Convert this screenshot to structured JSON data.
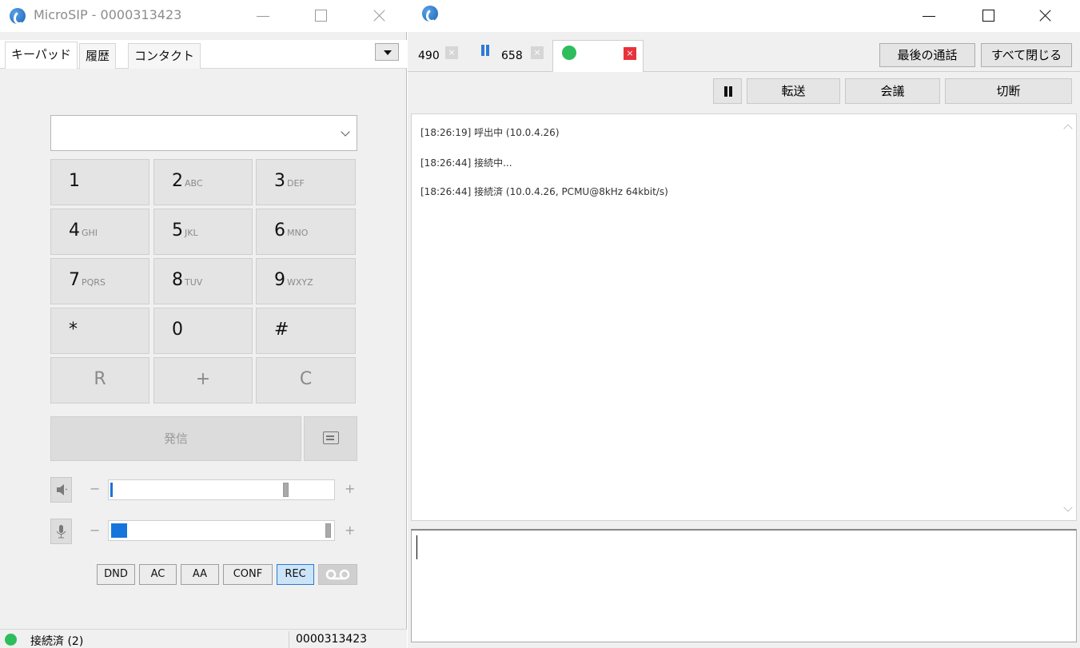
{
  "left_window": {
    "title": "MicroSIP - 0000313423",
    "tabs": [
      {
        "label": "キーパッド",
        "active": true
      },
      {
        "label": "履歴",
        "active": false
      },
      {
        "label": "コンタクト",
        "active": false
      }
    ],
    "dial_input": {
      "value": ""
    },
    "keypad": [
      {
        "digit": "1",
        "letters": ""
      },
      {
        "digit": "2",
        "letters": "ABC"
      },
      {
        "digit": "3",
        "letters": "DEF"
      },
      {
        "digit": "4",
        "letters": "GHI"
      },
      {
        "digit": "5",
        "letters": "JKL"
      },
      {
        "digit": "6",
        "letters": "MNO"
      },
      {
        "digit": "7",
        "letters": "PQRS"
      },
      {
        "digit": "8",
        "letters": "TUV"
      },
      {
        "digit": "9",
        "letters": "WXYZ"
      },
      {
        "digit": "*",
        "letters": ""
      },
      {
        "digit": "0",
        "letters": ""
      },
      {
        "digit": "#",
        "letters": ""
      }
    ],
    "keypad_extra": [
      "R",
      "+",
      "C"
    ],
    "call_label": "発信",
    "speaker": {
      "minus": "−",
      "plus": "+",
      "level": 0.01
    },
    "microphone": {
      "minus": "−",
      "plus": "+",
      "level": 0.07
    },
    "flags": [
      {
        "label": "DND",
        "active": false
      },
      {
        "label": "AC",
        "active": false
      },
      {
        "label": "AA",
        "active": false
      },
      {
        "label": "CONF",
        "active": false
      },
      {
        "label": "REC",
        "active": true
      }
    ],
    "status": {
      "text": "接続済 (2)",
      "account": "0000313423",
      "color": "#2ebd5c"
    }
  },
  "right_window": {
    "call_tabs": [
      {
        "label": "490",
        "state": "idle"
      },
      {
        "label": "658",
        "state": "hold"
      },
      {
        "label": "",
        "state": "active"
      }
    ],
    "top_buttons": [
      "最後の通話",
      "すべて閉じる"
    ],
    "actions": [
      "転送",
      "会議",
      "切断"
    ],
    "log": [
      "[18:26:19]  呼出中 (10.0.4.26)",
      "[18:26:44]  接続中...",
      "[18:26:44]  接続済 (10.0.4.26, PCMU@8kHz 64kbit/s)"
    ],
    "message_input": ""
  },
  "colors": {
    "accent": "#1f72d8",
    "connected": "#2ebd5c",
    "close_red": "#e8323c"
  }
}
